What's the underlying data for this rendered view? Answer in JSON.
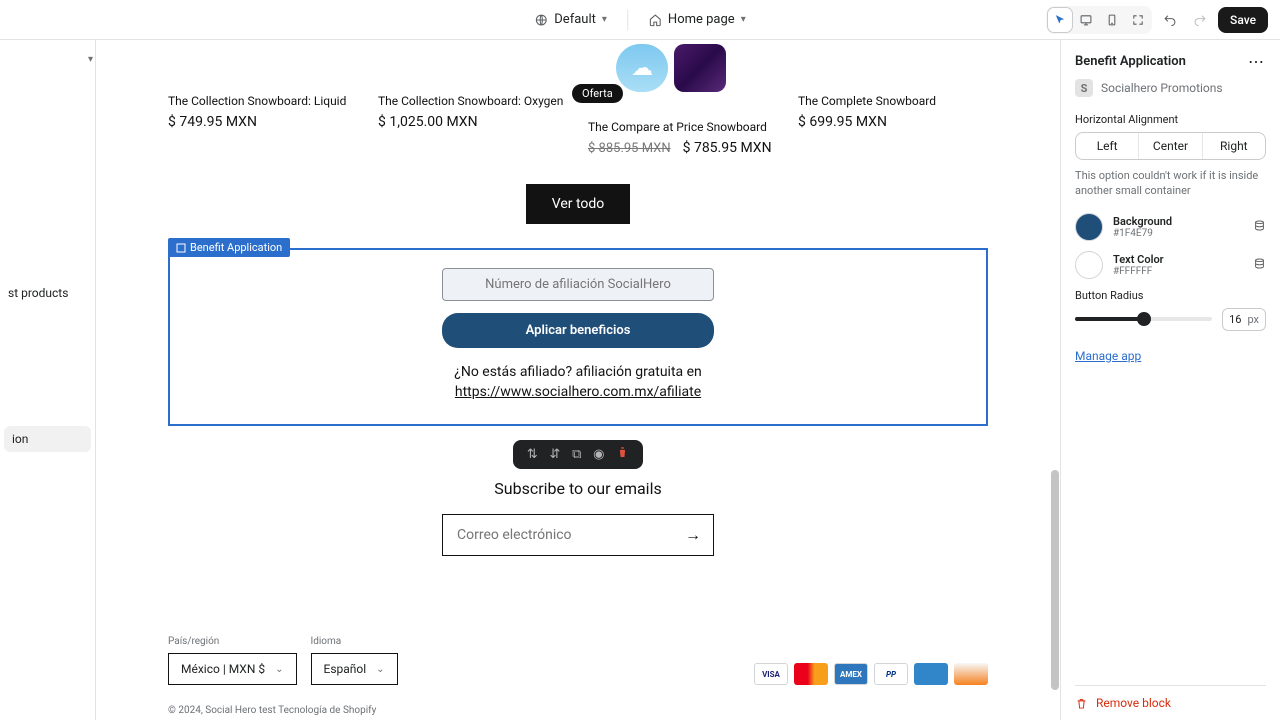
{
  "topbar": {
    "theme_label": "Default",
    "page_label": "Home page",
    "save_label": "Save"
  },
  "left_rail": {
    "items": [
      "st products",
      "ion"
    ]
  },
  "products": [
    {
      "title": "The Collection Snowboard: Liquid",
      "price": "$ 749.95 MXN"
    },
    {
      "title": "The Collection Snowboard: Oxygen",
      "price": "$ 1,025.00 MXN"
    },
    {
      "title": "The Compare at Price Snowboard",
      "strike": "$ 885.95 MXN",
      "price": "$ 785.95 MXN",
      "sale": "Oferta"
    },
    {
      "title": "The Complete Snowboard",
      "price": "$ 699.95 MXN"
    }
  ],
  "ver_todo": "Ver todo",
  "benefit": {
    "tag": "Benefit Application",
    "placeholder": "Número de afiliación SocialHero",
    "apply": "Aplicar beneficios",
    "question": "¿No estás afiliado? afiliación gratuita en",
    "link": "https://www.socialhero.com.mx/afiliate"
  },
  "newsletter": {
    "title": "Subscribe to our emails",
    "placeholder": "Correo electrónico"
  },
  "footer": {
    "country_lbl": "País/región",
    "country_val": "México | MXN $",
    "lang_lbl": "Idioma",
    "lang_val": "Español",
    "copyright": "© 2024, Social Hero test Tecnología de Shopify"
  },
  "panel": {
    "title": "Benefit Application",
    "app": "Socialhero Promotions",
    "h_align": "Horizontal Alignment",
    "align_opts": [
      "Left",
      "Center",
      "Right"
    ],
    "hint": "This option couldn't work if it is inside another small container",
    "bg_label": "Background",
    "bg_hex": "#1F4E79",
    "txt_label": "Text Color",
    "txt_hex": "#FFFFFF",
    "radius_label": "Button Radius",
    "radius_val": "16",
    "radius_unit": "px",
    "manage": "Manage app",
    "remove": "Remove block"
  }
}
